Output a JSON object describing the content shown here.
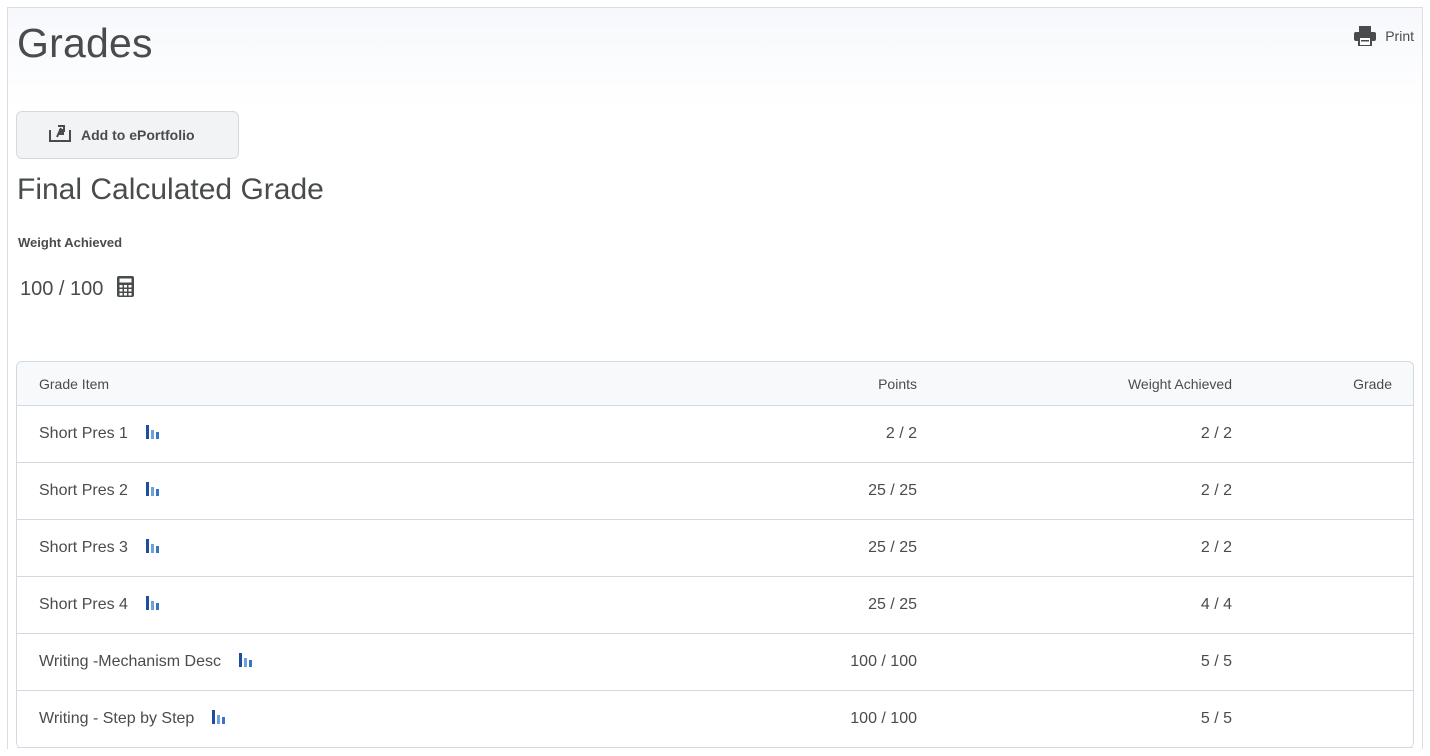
{
  "page": {
    "title": "Grades"
  },
  "toolbar": {
    "print_label": "Print",
    "eportfolio_label": "Add to ePortfolio"
  },
  "final_grade": {
    "title": "Final Calculated Grade",
    "weight_label": "Weight Achieved",
    "weight_value": "100 / 100",
    "calculator_icon": "calculator-icon"
  },
  "table": {
    "headers": {
      "item": "Grade Item",
      "points": "Points",
      "weight": "Weight Achieved",
      "grade": "Grade"
    },
    "rows": [
      {
        "item": "Short Pres 1",
        "points": "2 / 2",
        "weight": "2 / 2",
        "grade": ""
      },
      {
        "item": "Short Pres 2",
        "points": "25 / 25",
        "weight": "2 / 2",
        "grade": ""
      },
      {
        "item": "Short Pres 3",
        "points": "25 / 25",
        "weight": "2 / 2",
        "grade": ""
      },
      {
        "item": "Short Pres 4",
        "points": "25 / 25",
        "weight": "4 / 4",
        "grade": ""
      },
      {
        "item": "Writing -Mechanism Desc",
        "points": "100 / 100",
        "weight": "5 / 5",
        "grade": ""
      },
      {
        "item": "Writing - Step by Step",
        "points": "100 / 100",
        "weight": "5 / 5",
        "grade": ""
      }
    ]
  },
  "colors": {
    "text": "#494c4e",
    "border": "#d3d9e3",
    "stats_dark": "#1f4e9e",
    "stats_light": "#6fa0dc"
  }
}
